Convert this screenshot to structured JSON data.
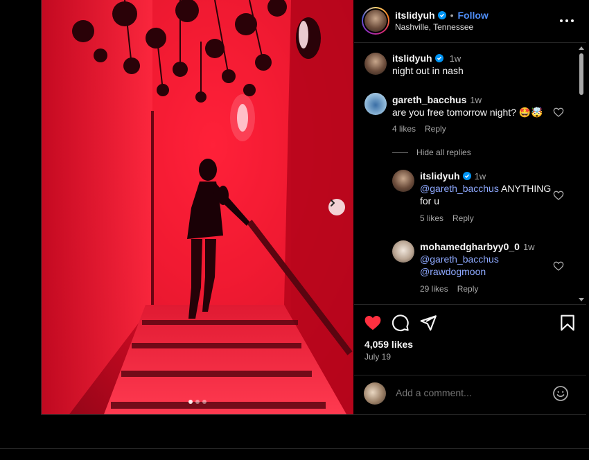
{
  "post": {
    "author": "itslidyuh",
    "follow_label": "Follow",
    "separator": "•",
    "location": "Nashville, Tennessee"
  },
  "media": {
    "carousel_count": 3,
    "carousel_active": 1
  },
  "caption": {
    "user": "itslidyuh",
    "time": "1w",
    "text": "night out in nash"
  },
  "comments": [
    {
      "user": "gareth_bacchus",
      "time": "1w",
      "text": "are you free tomorrow night? 🤩🤯",
      "likes": "4 likes",
      "reply_label": "Reply"
    }
  ],
  "hide_replies_label": "Hide all replies",
  "replies": [
    {
      "user": "itslidyuh",
      "time": "1w",
      "mention": "@gareth_bacchus",
      "text": "ANYTHING",
      "text2": "for u",
      "likes": "5 likes",
      "reply_label": "Reply"
    },
    {
      "user": "mohamedgharbyy0_0",
      "time": "1w",
      "mention": "@gareth_bacchus",
      "mention2": "@rawdogmoon",
      "likes": "29 likes",
      "reply_label": "Reply"
    }
  ],
  "engagement": {
    "likes": "4,059 likes",
    "date": "July 19",
    "liked": true
  },
  "add_comment": {
    "placeholder": "Add a comment..."
  },
  "colors": {
    "accent": "#0095f6",
    "follow": "#4f8ef7",
    "mention": "#8ea9ff",
    "like": "#ff3040",
    "background": "#000000"
  },
  "icons": [
    "verified-icon",
    "more-icon",
    "heart-icon",
    "comment-icon",
    "share-icon",
    "bookmark-icon",
    "emoji-icon",
    "chevron-right-icon"
  ]
}
